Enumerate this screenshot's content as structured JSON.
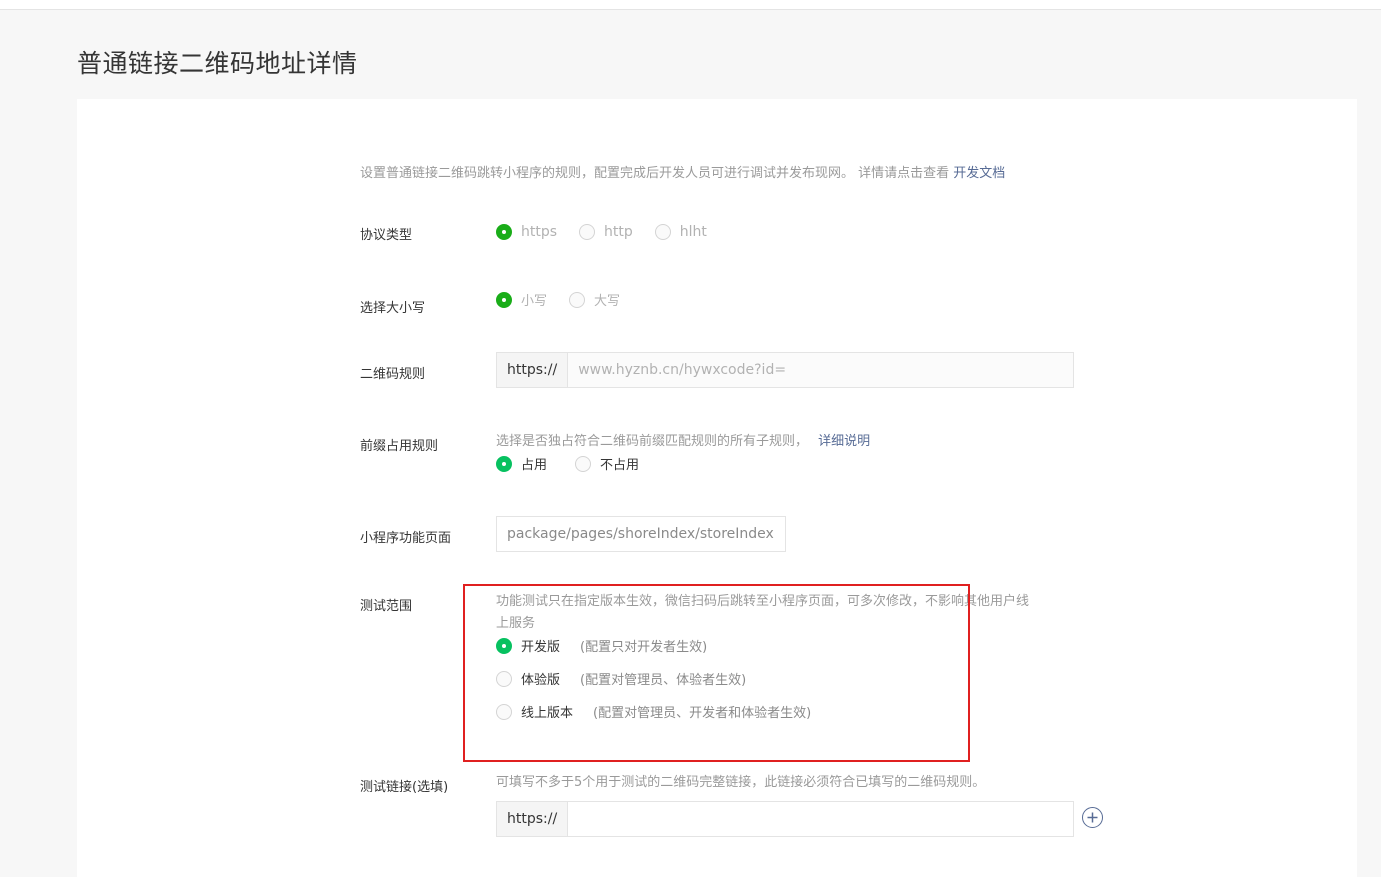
{
  "page": {
    "title": "普通链接二维码地址详情"
  },
  "intro": {
    "text": "设置普通链接二维码跳转小程序的规则，配置完成后开发人员可进行调试并发布现网。 详情请点击查看 ",
    "link_label": "开发文档"
  },
  "protocol": {
    "label": "协议类型",
    "options": [
      "https",
      "http",
      "hlht"
    ],
    "selected": "https"
  },
  "case": {
    "label": "选择大小写",
    "options": [
      "小写",
      "大写"
    ],
    "selected": "小写"
  },
  "qr_rule": {
    "label": "二维码规则",
    "prefix": "https://",
    "placeholder": "www.hyznb.cn/hywxcode?id="
  },
  "prefix_rule": {
    "label": "前缀占用规则",
    "help": "选择是否独占符合二维码前缀匹配规则的所有子规则，",
    "help_link": "详细说明",
    "options": [
      "占用",
      "不占用"
    ],
    "selected": "占用"
  },
  "mini_page": {
    "label": "小程序功能页面",
    "value": "package/pages/shoreIndex/storeIndex"
  },
  "test_scope": {
    "label": "测试范围",
    "help_line1": "功能测试只在指定版本生效，微信扫码后跳转至小程序页面，可多次修改，不影响其他用户线",
    "help_line2": "上服务",
    "options": [
      {
        "label": "开发版",
        "note": "(配置只对开发者生效)"
      },
      {
        "label": "体验版",
        "note": "(配置对管理员、体验者生效)"
      },
      {
        "label": "线上版本",
        "note": "(配置对管理员、开发者和体验者生效)"
      }
    ],
    "selected": "开发版"
  },
  "test_link": {
    "label": "测试链接(选填)",
    "help": "可填写不多于5个用于测试的二维码完整链接，此链接必须符合已填写的二维码规则。",
    "prefix": "https://",
    "value": ""
  },
  "colors": {
    "accent_green": "#1aad19",
    "link_blue": "#576b95",
    "highlight_red": "#e02020"
  },
  "icons": {
    "add": "plus-circle-icon"
  }
}
